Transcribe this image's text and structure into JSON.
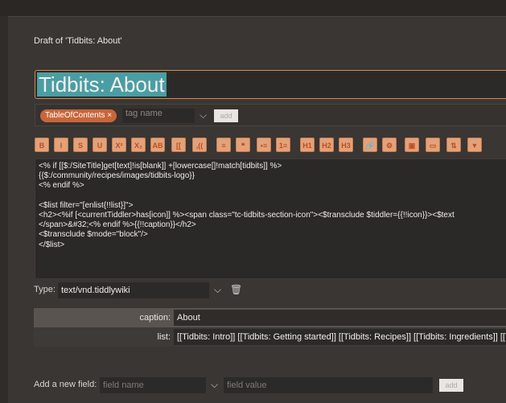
{
  "header": {
    "draft_title": "Draft of 'Tidbits: About'"
  },
  "title_input": {
    "value": "Tidbits: About"
  },
  "tags": {
    "items": [
      {
        "label": "TableOfContents",
        "remove": "×"
      }
    ],
    "input_placeholder": "tag name",
    "add_label": "add"
  },
  "toolbar": {
    "buttons": [
      "B",
      "I",
      "S",
      "U",
      "X²",
      "X₂",
      "AB",
      "[[",
      ",((",
      "",
      "❝",
      "•≡",
      "1≡",
      "H1",
      "H2",
      "H3",
      "🔗",
      "⚙",
      "▣",
      "▭",
      "⇅",
      "▼"
    ]
  },
  "editor": {
    "lines": [
      "<% if [[$:/SiteTitle]get[text]!is[blank]] +[lowercase[]!match[tidbits]] %>",
      "{{$:/community/recipes/images/tidbits-logo}}",
      "<% endif %>",
      "",
      "<$list filter=\"[enlist{!!list}]\">",
      "<h2><%if [<currentTiddler>has[icon]] %><span class=\"tc-tidbits-section-icon\"><$transclude $tiddler={{!!icon}}><$text",
      "</span>&#32;<% endif %>{{!!caption}}</h2>",
      "<$transclude $mode=\"block\"/>",
      "</$list>"
    ]
  },
  "type_field": {
    "label": "Type:",
    "value": "text/vnd.tiddlywiki"
  },
  "fields": [
    {
      "name": "caption:",
      "value": "About"
    },
    {
      "name": "list:",
      "value": "[[Tidbits: Intro]] [[Tidbits: Getting started]] [[Tidbits: Recipes]] [[Tidbits: Ingredients]] [[T"
    }
  ],
  "add_field": {
    "label": "Add a new field:",
    "name_placeholder": "field name",
    "value_placeholder": "field value",
    "add_label": "add"
  }
}
